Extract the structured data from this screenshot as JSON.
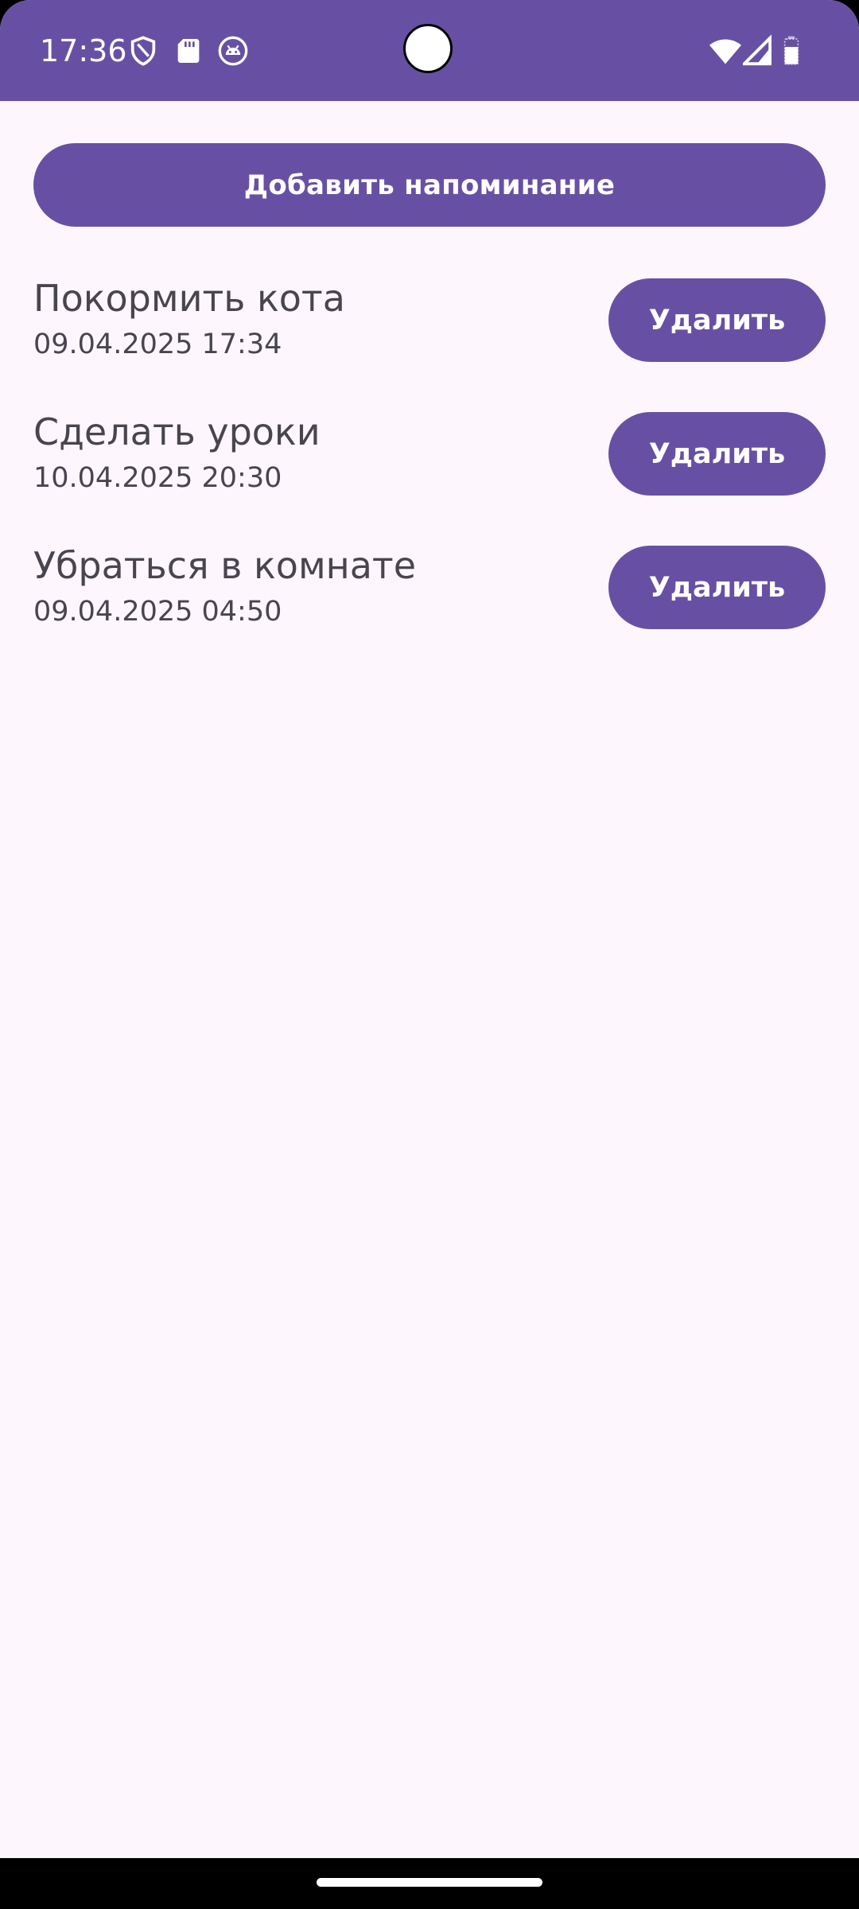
{
  "status_bar": {
    "time": "17:36",
    "background_color": "#6750A4",
    "icons_left": [
      "shield-icon",
      "sd-card-icon",
      "android-robot-icon"
    ],
    "icons_right": [
      "wifi-icon",
      "cell-signal-icon",
      "battery-icon"
    ]
  },
  "main": {
    "add_button_label": "Добавить напоминание",
    "reminders": [
      {
        "title": "Покормить кота",
        "datetime": "09.04.2025 17:34",
        "delete_label": "Удалить"
      },
      {
        "title": "Сделать уроки",
        "datetime": "10.04.2025 20:30",
        "delete_label": "Удалить"
      },
      {
        "title": "Убраться в комнате",
        "datetime": "09.04.2025 04:50",
        "delete_label": "Удалить"
      }
    ]
  },
  "colors": {
    "accent": "#6750A4",
    "background": "#FDF7FD",
    "text": "#49454F"
  }
}
